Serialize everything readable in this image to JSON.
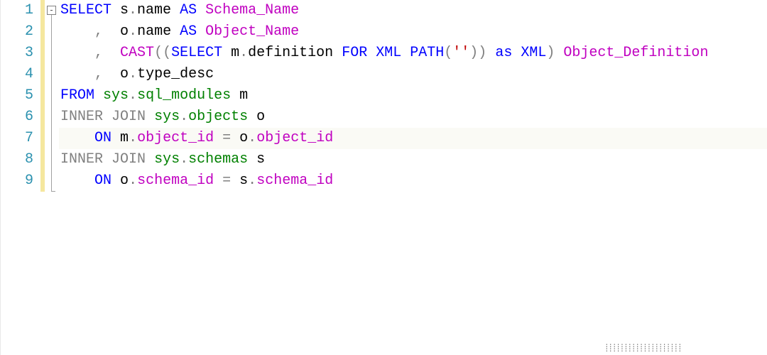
{
  "line_numbers": [
    "1",
    "2",
    "3",
    "4",
    "5",
    "6",
    "7",
    "8",
    "9"
  ],
  "fold_glyph": "-",
  "code": {
    "l1": {
      "t1": "SELECT",
      "t2": " s",
      "t3": ".",
      "t4": "name",
      "t5": " ",
      "t6": "AS",
      "t7": " ",
      "t8": "Schema_Name"
    },
    "l2": {
      "ind": "    ",
      "c": ",",
      "sp": "  ",
      "t1": "o",
      "d": ".",
      "t2": "name",
      "sp2": " ",
      "as": "AS",
      "sp3": " ",
      "t3": "Object_Name"
    },
    "l3": {
      "ind": "    ",
      "c": ",",
      "sp": "  ",
      "cast": "CAST",
      "op": "((",
      "sel": "SELECT",
      "sp2": " ",
      "m": "m",
      "d": ".",
      "def": "definition",
      "sp3": " ",
      "for": "FOR",
      "sp4": " ",
      "xml": "XML",
      "sp5": " ",
      "path": "PATH",
      "op2": "(",
      "q": "''",
      "op3": "))",
      "sp6": " ",
      "as": "as",
      "sp7": " ",
      "xml2": "XML",
      "op4": ")",
      "sp8": " ",
      "od": "Object_Definition"
    },
    "l4": {
      "ind": "    ",
      "c": ",",
      "sp": "  ",
      "t1": "o",
      "d": ".",
      "t2": "type_desc"
    },
    "l5": {
      "from": "FROM",
      "sp": " ",
      "sys": "sys",
      "d": ".",
      "tbl": "sql_modules",
      "sp2": " ",
      "al": "m"
    },
    "l6": {
      "ij": "INNER",
      "sp": " ",
      "jn": "JOIN",
      "sp2": " ",
      "sys": "sys",
      "d": ".",
      "tbl": "objects",
      "sp3": " ",
      "al": "o"
    },
    "l7": {
      "ind": "    ",
      "on": "ON",
      "sp": " ",
      "a": "m",
      "d": ".",
      "c1": "object_id",
      "sp2": " ",
      "eq": "=",
      "sp3": " ",
      "b": "o",
      "d2": ".",
      "c2": "object_id"
    },
    "l8": {
      "ij": "INNER",
      "sp": " ",
      "jn": "JOIN",
      "sp2": " ",
      "sys": "sys",
      "d": ".",
      "tbl": "schemas",
      "sp3": " ",
      "al": "s"
    },
    "l9": {
      "ind": "    ",
      "on": "ON",
      "sp": " ",
      "a": "o",
      "d": ".",
      "c1": "schema_id",
      "sp2": " ",
      "eq": "=",
      "sp3": " ",
      "b": "s",
      "d2": ".",
      "c2": "schema_id"
    }
  }
}
